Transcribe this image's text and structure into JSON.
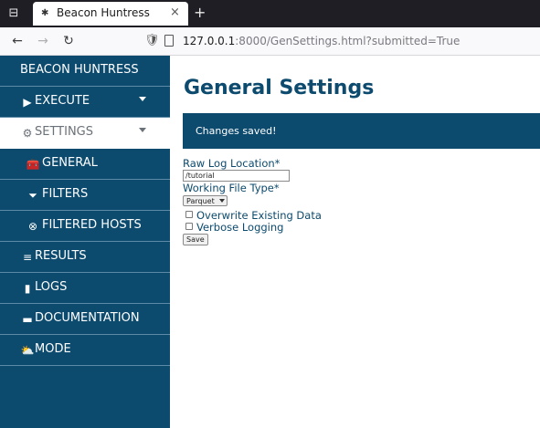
{
  "browser": {
    "tab_title": "Beacon Huntress",
    "url_host": "127.0.0.1",
    "url_rest": ":8000/GenSettings.html?submitted=True",
    "glyphs": {
      "tab_overview": "⊟",
      "tab_favicon": "✱",
      "tab_close": "×",
      "new_tab": "+",
      "back": "←",
      "forward": "→",
      "reload": "↻",
      "shield": "🛡"
    }
  },
  "sidebar": {
    "brand": "BEACON HUNTRESS",
    "items": [
      {
        "label": "EXECUTE",
        "icon": "play-icon",
        "glyph": "▶"
      },
      {
        "label": "SETTINGS",
        "icon": "gears-icon",
        "glyph": "⚙"
      },
      {
        "label": "GENERAL",
        "icon": "toolbox-icon",
        "glyph": "🧰"
      },
      {
        "label": "FILTERS",
        "icon": "filter-icon",
        "glyph": "⏷"
      },
      {
        "label": "FILTERED HOSTS",
        "icon": "circle-x-icon",
        "glyph": "⊗"
      },
      {
        "label": "RESULTS",
        "icon": "database-icon",
        "glyph": "≡"
      },
      {
        "label": "LOGS",
        "icon": "file-icon",
        "glyph": "▮"
      },
      {
        "label": "DOCUMENTATION",
        "icon": "book-icon",
        "glyph": "▬"
      },
      {
        "label": "MODE",
        "icon": "cloud-sun-icon",
        "glyph": "⛅"
      }
    ]
  },
  "main": {
    "title": "General Settings",
    "alert": "Changes saved!",
    "form": {
      "raw_log_label": "Raw Log Location*",
      "raw_log_value": "/tutorial",
      "file_type_label": "Working File Type*",
      "file_type_value": "Parquet",
      "overwrite_label": "Overwrite Existing Data",
      "verbose_label": "Verbose Logging",
      "save_label": "Save"
    }
  },
  "colors": {
    "primary": "#0c4a6e",
    "sidebar_divider": "#5d8aa6",
    "active_text": "#6b7178",
    "chrome_dark": "#1f1e24"
  }
}
